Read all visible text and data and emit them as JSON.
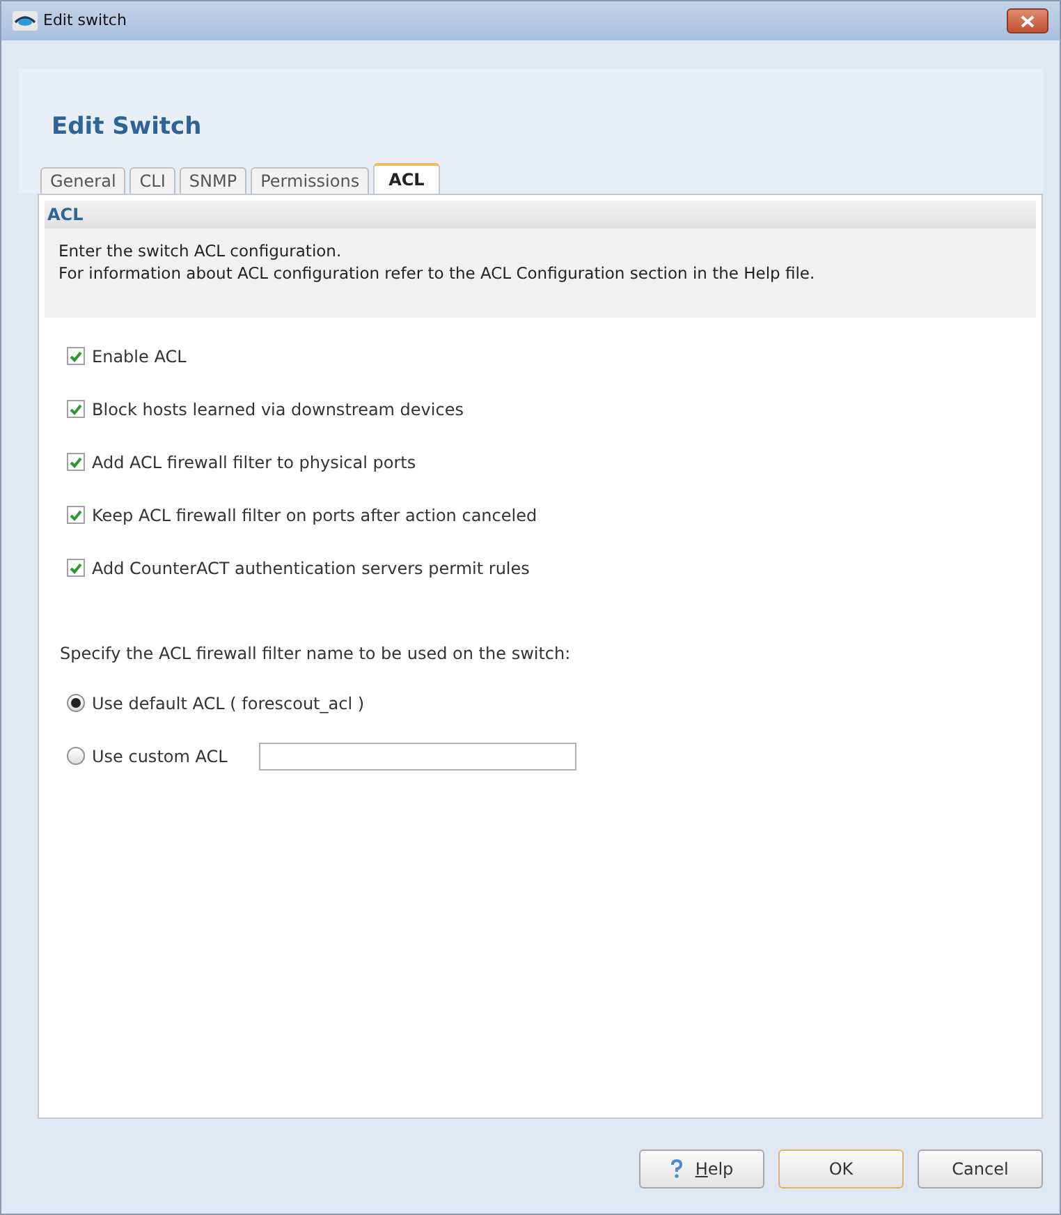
{
  "window": {
    "title": "Edit switch"
  },
  "heading": "Edit Switch",
  "tabs": [
    {
      "label": "General",
      "selected": false
    },
    {
      "label": "CLI",
      "selected": false
    },
    {
      "label": "SNMP",
      "selected": false
    },
    {
      "label": "Permissions",
      "selected": false
    },
    {
      "label": "ACL",
      "selected": true
    }
  ],
  "section": {
    "title": "ACL",
    "description": [
      "Enter the switch ACL configuration.",
      "For information about ACL configuration refer to the ACL Configuration section in the Help file."
    ]
  },
  "options": [
    {
      "label": "Enable ACL",
      "checked": true
    },
    {
      "label": "Block hosts learned via downstream devices",
      "checked": true
    },
    {
      "label": "Add ACL firewall filter to physical ports",
      "checked": true
    },
    {
      "label": "Keep ACL firewall filter on ports after action canceled",
      "checked": true
    },
    {
      "label": "Add CounterACT authentication servers permit rules",
      "checked": true
    }
  ],
  "filter_prompt": "Specify the ACL firewall filter name to be used on the switch:",
  "filter_choices": [
    {
      "label": "Use default ACL ( forescout_acl )",
      "selected": true,
      "kind": "plain"
    },
    {
      "label": "Use custom ACL",
      "selected": false,
      "kind": "field"
    }
  ],
  "buttons": [
    {
      "label": "Help",
      "kind": "help"
    },
    {
      "label": "OK",
      "kind": "default"
    },
    {
      "label": "Cancel",
      "kind": "plain"
    }
  ]
}
